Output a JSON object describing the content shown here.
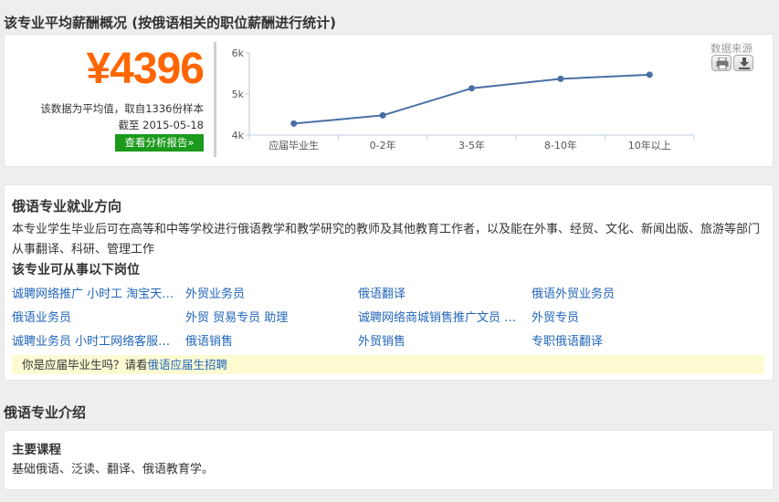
{
  "salary_section": {
    "title": "该专业平均薪酬概况 (按俄语相关的职位薪酬进行统计)",
    "amount": "¥4396",
    "note": "该数据为平均值，取自1336份样本",
    "date": "截至 2015-05-18",
    "report_button": "查看分析报告»",
    "source_label": "数据来源"
  },
  "chart_data": {
    "type": "line",
    "categories": [
      "应届毕业生",
      "0-2年",
      "3-5年",
      "8-10年",
      "10年以上"
    ],
    "values": [
      4280,
      4480,
      5140,
      5370,
      5470
    ],
    "y_ticks": [
      "4k",
      "5k",
      "6k"
    ],
    "ylim": [
      4000,
      6000
    ],
    "grid": false,
    "color": "#4a6fa5"
  },
  "employment": {
    "title": "俄语专业就业方向",
    "description": "本专业学生毕业后可在高等和中等学校进行俄语教学和教学研究的教师及其他教育工作者，以及能在外事、经贸、文化、新闻出版、旅游等部门从事翻译、科研、管理工作",
    "jobs_title": "该专业可从事以下岗位",
    "jobs": [
      [
        "诚聘网络推广 小时工 淘宝天…",
        "外贸业务员",
        "俄语翻译",
        "俄语外贸业务员"
      ],
      [
        "俄语业务员",
        "外贸 贸易专员 助理",
        "诚聘网络商城销售推广文员 …",
        "外贸专员"
      ],
      [
        "诚聘业务员 小时工网络客服…",
        "俄语销售",
        "外贸销售",
        "专职俄语翻译"
      ]
    ],
    "grad_prompt": "你是应届毕业生吗？请看",
    "grad_link": "俄语应届生招聘"
  },
  "intro": {
    "title": "俄语专业介绍",
    "courses_title": "主要课程",
    "courses": "基础俄语、泛读、翻译、俄语教育学。"
  }
}
